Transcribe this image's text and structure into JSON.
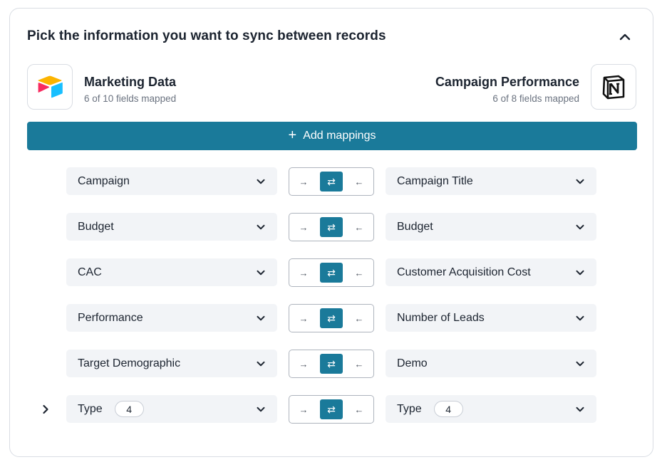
{
  "header": {
    "title": "Pick the information you want to sync between records"
  },
  "source": {
    "name": "Marketing Data",
    "fields_mapped": "6 of 10 fields mapped",
    "logo": "airtable-logo"
  },
  "destination": {
    "name": "Campaign Performance",
    "fields_mapped": "6 of 8 fields mapped",
    "logo": "notion-logo"
  },
  "add_button": {
    "label": "Add mappings",
    "icon": "plus-icon"
  },
  "direction_icons": {
    "to_right": "→",
    "two_way": "⇄",
    "to_left": "←"
  },
  "colors": {
    "accent": "#1a7a9a",
    "field_bg": "#f2f4f7"
  },
  "mappings": [
    {
      "left": "Campaign",
      "right": "Campaign Title",
      "direction": "two-way"
    },
    {
      "left": "Budget",
      "right": "Budget",
      "direction": "two-way"
    },
    {
      "left": "CAC",
      "right": "Customer Acquisition Cost",
      "direction": "two-way"
    },
    {
      "left": "Performance",
      "right": "Number of Leads",
      "direction": "two-way"
    },
    {
      "left": "Target Demographic",
      "right": "Demo",
      "direction": "two-way"
    },
    {
      "left": "Type",
      "left_count": "4",
      "right": "Type",
      "right_count": "4",
      "direction": "two-way",
      "expandable": true
    }
  ]
}
